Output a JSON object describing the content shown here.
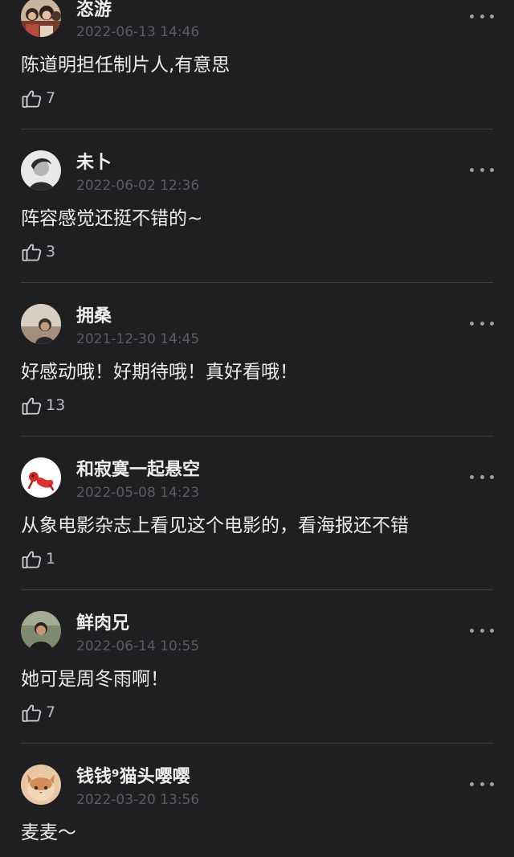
{
  "comments": [
    {
      "username": "恣游",
      "time": "2022-06-13 14:46",
      "text": "陈道明担任制片人,有意思",
      "likes": "7",
      "avatar_icon": "group-photo-avatar",
      "avatar_color": "#a37b5a"
    },
    {
      "username": "未卜",
      "time": "2022-06-02 12:36",
      "text": "阵容感觉还挺不错的~",
      "likes": "3",
      "avatar_icon": "bw-portrait-avatar",
      "avatar_color": "#8d8d8d"
    },
    {
      "username": "拥桑",
      "time": "2021-12-30 14:45",
      "text": "好感动哦！好期待哦！真好看哦！",
      "likes": "13",
      "avatar_icon": "sunset-portrait-avatar",
      "avatar_color": "#b9a491"
    },
    {
      "username": "和寂寞一起悬空",
      "time": "2022-05-08 14:23",
      "text": "从象电影杂志上看见这个电影的，看海报还不错",
      "likes": "1",
      "avatar_icon": "red-cartoon-avatar",
      "avatar_color": "#ffffff"
    },
    {
      "username": "鲜肉兄",
      "time": "2022-06-14 10:55",
      "text": "她可是周冬雨啊！",
      "likes": "7",
      "avatar_icon": "outdoor-portrait-avatar",
      "avatar_color": "#6e7b64"
    },
    {
      "username": "钱钱⁹猫头嘤嘤",
      "time": "2022-03-20 13:56",
      "text": "麦麦～",
      "likes": "",
      "avatar_icon": "cat-avatar",
      "avatar_color": "#d9a57a"
    }
  ]
}
